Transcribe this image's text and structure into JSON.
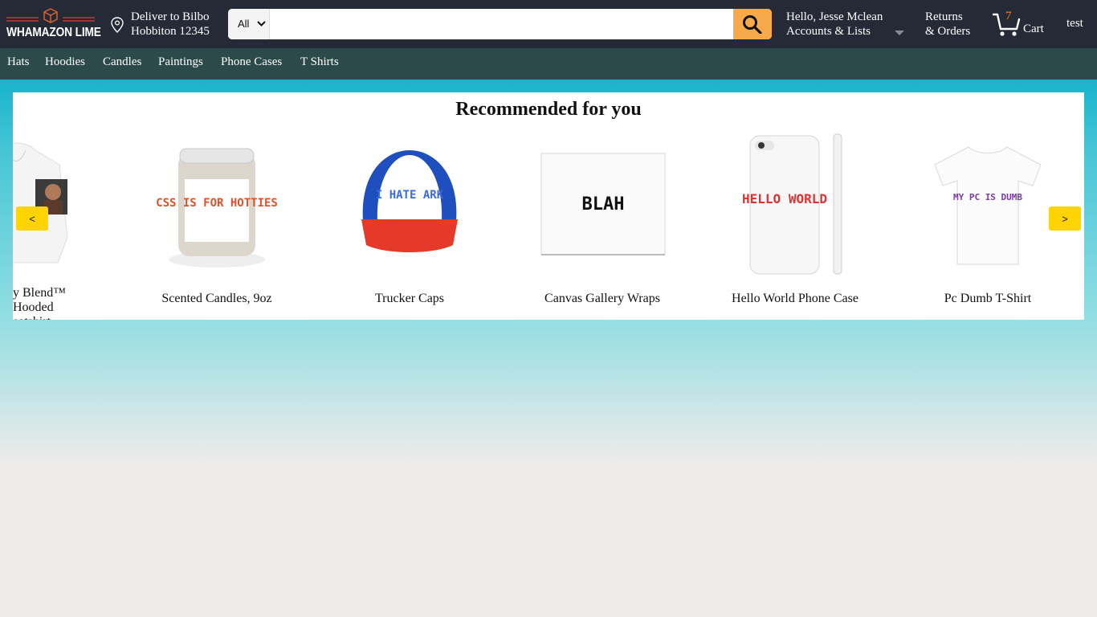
{
  "header": {
    "logo_text": "WHAMAZON LIME",
    "deliver_line1": "Deliver to Bilbo",
    "deliver_line2": "Hobbiton 12345",
    "search": {
      "category": "All",
      "placeholder": "",
      "value": ""
    },
    "account_line1": "Hello, Jesse Mclean",
    "account_line2": "Accounts & Lists",
    "returns_line1": "Returns",
    "returns_line2": "& Orders",
    "cart_count": "7",
    "cart_label": "Cart",
    "username": "test"
  },
  "subnav": [
    "Hats",
    "Hoodies",
    "Candles",
    "Paintings",
    "Phone Cases",
    "T Shirts"
  ],
  "recommended": {
    "title": "Recommended for you",
    "prev_label": "<",
    "next_label": ">",
    "items": [
      {
        "name_line1": "y Blend™ Hooded",
        "name_line2": "eatshirt"
      },
      {
        "name": "Scented Candles, 9oz",
        "print": "CSS IS FOR HOTTIES"
      },
      {
        "name": "Trucker Caps",
        "print": "I HATE ARK"
      },
      {
        "name": "Canvas Gallery Wraps",
        "print": "BLAH"
      },
      {
        "name": "Hello World Phone Case",
        "print": "HELLO WORLD"
      },
      {
        "name": "Pc Dumb T-Shirt",
        "print": "MY PC IS DUMB"
      }
    ]
  },
  "colors": {
    "header_bg": "#262a37",
    "subnav_bg": "#2c4a4a",
    "search_button": "#f6aa4c",
    "carousel_button": "#ffd400",
    "cart_count": "#f08a24"
  }
}
